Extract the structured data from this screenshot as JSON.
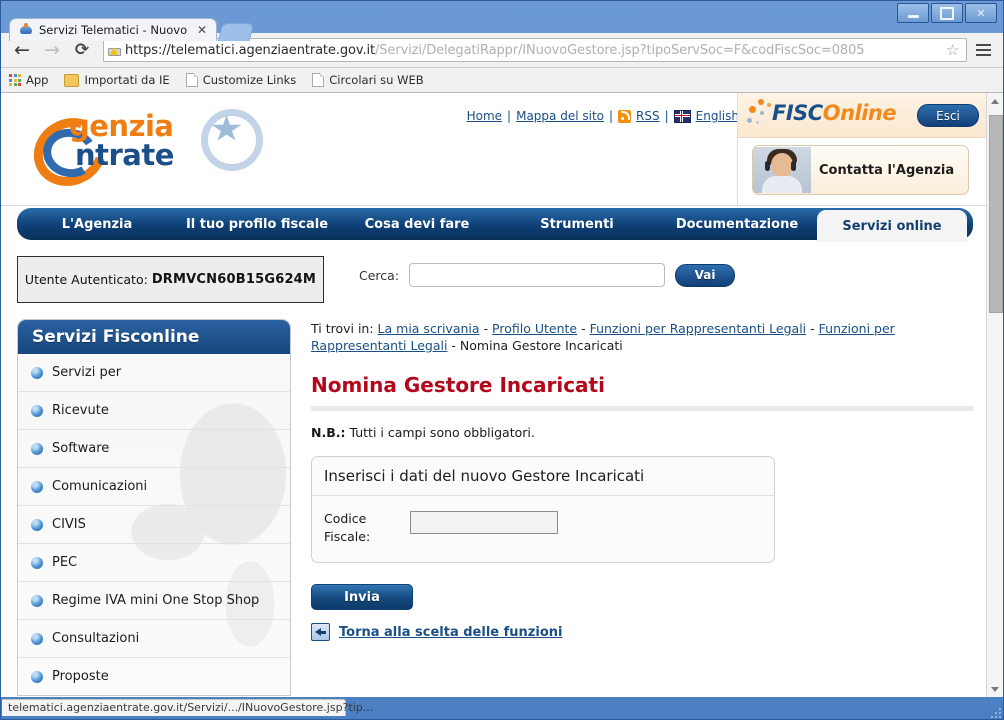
{
  "browser": {
    "tab_title": "Servizi Telematici - Nuovo ge",
    "tab_close": "✕",
    "url_scheme_host": "https://telematici.agenziaentrate.gov.it",
    "url_path": "/Servizi/DelegatiRappr/INuovoGestore.jsp?tipoServSoc=F&codFiscSoc=0805",
    "back_glyph": "←",
    "forward_glyph": "→",
    "reload_glyph": "⟳",
    "star_glyph": "☆",
    "minimize_label": "—",
    "maximize_label": "□",
    "close_label": "✕",
    "bookmarks": [
      {
        "label": "App",
        "icon": "apps-grid-icon"
      },
      {
        "label": "Importati da IE",
        "icon": "folder-icon"
      },
      {
        "label": "Customize Links",
        "icon": "page-icon"
      },
      {
        "label": "Circolari su WEB",
        "icon": "page-icon"
      }
    ],
    "status_text": "telematici.agenziaentrate.gov.it/Servizi/.../INuovoGestore.jsp?tip..."
  },
  "site_header": {
    "logo_top": "genzia",
    "logo_bottom": "ntrate",
    "top_links": [
      {
        "label": "Home"
      },
      {
        "label": "Mappa del sito"
      },
      {
        "label": "RSS",
        "icon": "rss-icon"
      },
      {
        "label": "English",
        "icon": "uk-flag-icon"
      }
    ],
    "separator": "|",
    "search_label": "Cerca:",
    "search_value": "",
    "search_placeholder": "",
    "search_button": "Vai"
  },
  "fisconline": {
    "brand_first": "FISC",
    "brand_second": "O",
    "brand_third": "nline",
    "logout_button": "Esci",
    "contact_banner": "Contatta l'Agenzia"
  },
  "main_nav": {
    "items": [
      {
        "label": "L'Agenzia",
        "active": false
      },
      {
        "label": "Il tuo profilo fiscale",
        "active": false
      },
      {
        "label": "Cosa devi fare",
        "active": false
      },
      {
        "label": "Strumenti",
        "active": false
      },
      {
        "label": "Documentazione",
        "active": false
      },
      {
        "label": "Servizi online",
        "active": true
      }
    ]
  },
  "auth": {
    "label": "Utente Autenticato:",
    "user_code": "DRMVCN60B15G624M"
  },
  "sidebar": {
    "title": "Servizi Fisconline",
    "items": [
      {
        "label": "Servizi per"
      },
      {
        "label": "Ricevute"
      },
      {
        "label": "Software"
      },
      {
        "label": "Comunicazioni"
      },
      {
        "label": "CIVIS"
      },
      {
        "label": "PEC"
      },
      {
        "label": "Regime IVA mini One Stop Shop"
      },
      {
        "label": "Consultazioni"
      },
      {
        "label": "Proposte"
      }
    ]
  },
  "breadcrumb": {
    "prefix": "Ti trovi in:",
    "sep": "-",
    "items": [
      {
        "label": "La mia scrivania",
        "link": true
      },
      {
        "label": "Profilo Utente",
        "link": true
      },
      {
        "label": "Funzioni per Rappresentanti Legali",
        "link": true
      },
      {
        "label": "Funzioni per Rappresentanti Legali",
        "link": true
      },
      {
        "label": "Nomina Gestore Incaricati",
        "link": false
      }
    ]
  },
  "content": {
    "page_title": "Nomina Gestore Incaricati",
    "note_bold": "N.B.:",
    "note_text": "Tutti i campi sono obbligatori.",
    "form_panel_title": "Inserisci i dati del nuovo Gestore Incaricati",
    "field_label": "Codice Fiscale:",
    "field_value": "",
    "field_placeholder": "",
    "submit_button": "Invia",
    "back_link": "Torna alla scelta delle funzioni"
  },
  "colors": {
    "nav_blue": "#0e3f76",
    "title_red": "#b3081c",
    "logo_orange": "#ef7d12",
    "logo_blue": "#1b4f8a",
    "link_blue": "#1a4f87"
  }
}
